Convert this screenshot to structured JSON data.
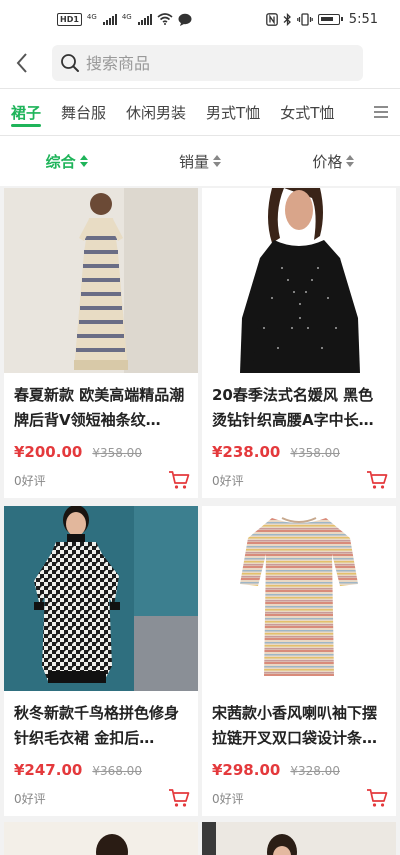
{
  "status_bar": {
    "net_badge": "HD",
    "net_badge2": "1",
    "signal1": "4G",
    "signal2": "4G",
    "time": "5:51"
  },
  "search": {
    "placeholder": "搜索商品"
  },
  "tabs": [
    {
      "label": "裙子",
      "active": true
    },
    {
      "label": "舞台服"
    },
    {
      "label": "休闲男装"
    },
    {
      "label": "男式T恤"
    },
    {
      "label": "女式T恤"
    }
  ],
  "sort": [
    {
      "label": "综合",
      "active": true
    },
    {
      "label": "销量"
    },
    {
      "label": "价格"
    }
  ],
  "products": [
    {
      "title": "春夏新款 欧美高端精品潮牌后背V领短袖条纹…",
      "price": "¥200.00",
      "original": "¥358.00",
      "reviews": "0好评"
    },
    {
      "title": "20春季法式名媛风 黑色烫钻针织高腰A字中长…",
      "price": "¥238.00",
      "original": "¥358.00",
      "reviews": "0好评"
    },
    {
      "title": "秋冬新款千鸟格拼色修身针织毛衣裙 金扣后…",
      "price": "¥247.00",
      "original": "¥368.00",
      "reviews": "0好评"
    },
    {
      "title": "宋茜款小香风喇叭袖下摆拉链开叉双口袋设计条…",
      "price": "¥298.00",
      "original": "¥328.00",
      "reviews": "0好评"
    }
  ],
  "colors": {
    "accent": "#1fb45a",
    "price": "#e4393c"
  },
  "icons": {
    "back": "chevron-left-icon",
    "search": "search-icon",
    "menu": "menu-icon",
    "cart": "cart-icon"
  }
}
